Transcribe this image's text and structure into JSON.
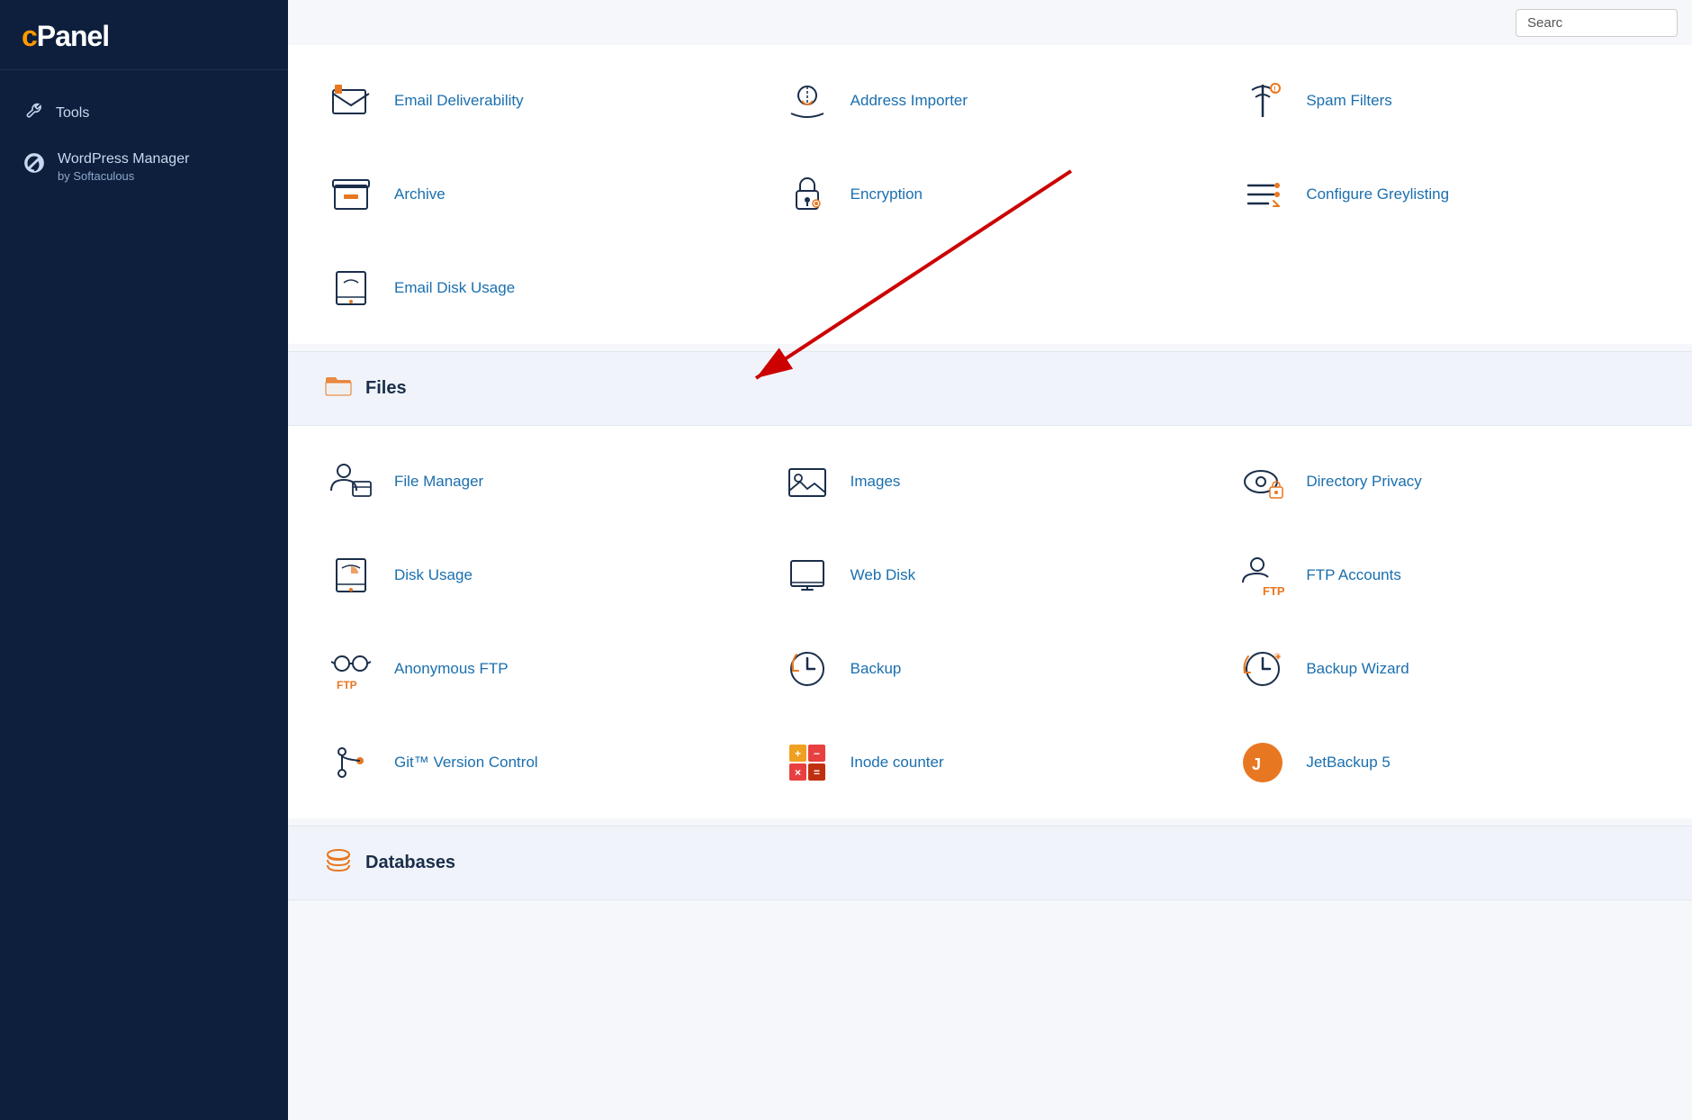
{
  "sidebar": {
    "logo": "cPanel",
    "items": [
      {
        "id": "tools",
        "label": "Tools",
        "icon": "tools-icon"
      },
      {
        "id": "wordpress-manager",
        "label": "WordPress Manager",
        "sublabel": "by Softaculous",
        "icon": "wordpress-icon"
      }
    ]
  },
  "search": {
    "placeholder": "Searc"
  },
  "sections": [
    {
      "id": "email-extra",
      "icon": "email-icon",
      "items": [
        {
          "id": "email-deliverability",
          "label": "Email Deliverability",
          "icon": "email-deliverability-icon"
        },
        {
          "id": "address-importer",
          "label": "Address Importer",
          "icon": "address-importer-icon"
        },
        {
          "id": "spam-filters",
          "label": "Spam Filters",
          "icon": "spam-filters-icon"
        },
        {
          "id": "archive",
          "label": "Archive",
          "icon": "archive-icon"
        },
        {
          "id": "encryption",
          "label": "Encryption",
          "icon": "encryption-icon"
        },
        {
          "id": "configure-greylisting",
          "label": "Configure Greylisting",
          "icon": "configure-greylisting-icon"
        },
        {
          "id": "email-disk-usage",
          "label": "Email Disk Usage",
          "icon": "email-disk-usage-icon"
        }
      ]
    },
    {
      "id": "files",
      "title": "Files",
      "icon": "folder-icon",
      "items": [
        {
          "id": "file-manager",
          "label": "File Manager",
          "icon": "file-manager-icon"
        },
        {
          "id": "images",
          "label": "Images",
          "icon": "images-icon"
        },
        {
          "id": "directory-privacy",
          "label": "Directory Privacy",
          "icon": "directory-privacy-icon"
        },
        {
          "id": "disk-usage",
          "label": "Disk Usage",
          "icon": "disk-usage-icon"
        },
        {
          "id": "web-disk",
          "label": "Web Disk",
          "icon": "web-disk-icon"
        },
        {
          "id": "ftp-accounts",
          "label": "FTP Accounts",
          "icon": "ftp-accounts-icon"
        },
        {
          "id": "anonymous-ftp",
          "label": "Anonymous FTP",
          "icon": "anonymous-ftp-icon"
        },
        {
          "id": "backup",
          "label": "Backup",
          "icon": "backup-icon"
        },
        {
          "id": "backup-wizard",
          "label": "Backup Wizard",
          "icon": "backup-wizard-icon"
        },
        {
          "id": "git-version-control",
          "label": "Git™ Version Control",
          "icon": "git-icon"
        },
        {
          "id": "inode-counter",
          "label": "Inode counter",
          "icon": "inode-counter-icon"
        },
        {
          "id": "jetbackup-5",
          "label": "JetBackup 5",
          "icon": "jetbackup-icon"
        }
      ]
    },
    {
      "id": "databases",
      "title": "Databases",
      "icon": "databases-icon",
      "items": []
    }
  ],
  "colors": {
    "sidebar_bg": "#0d1f3c",
    "link_blue": "#1a6faf",
    "icon_orange": "#e87722",
    "section_bg": "#f0f4fa",
    "arrow_red": "#cc0000"
  }
}
